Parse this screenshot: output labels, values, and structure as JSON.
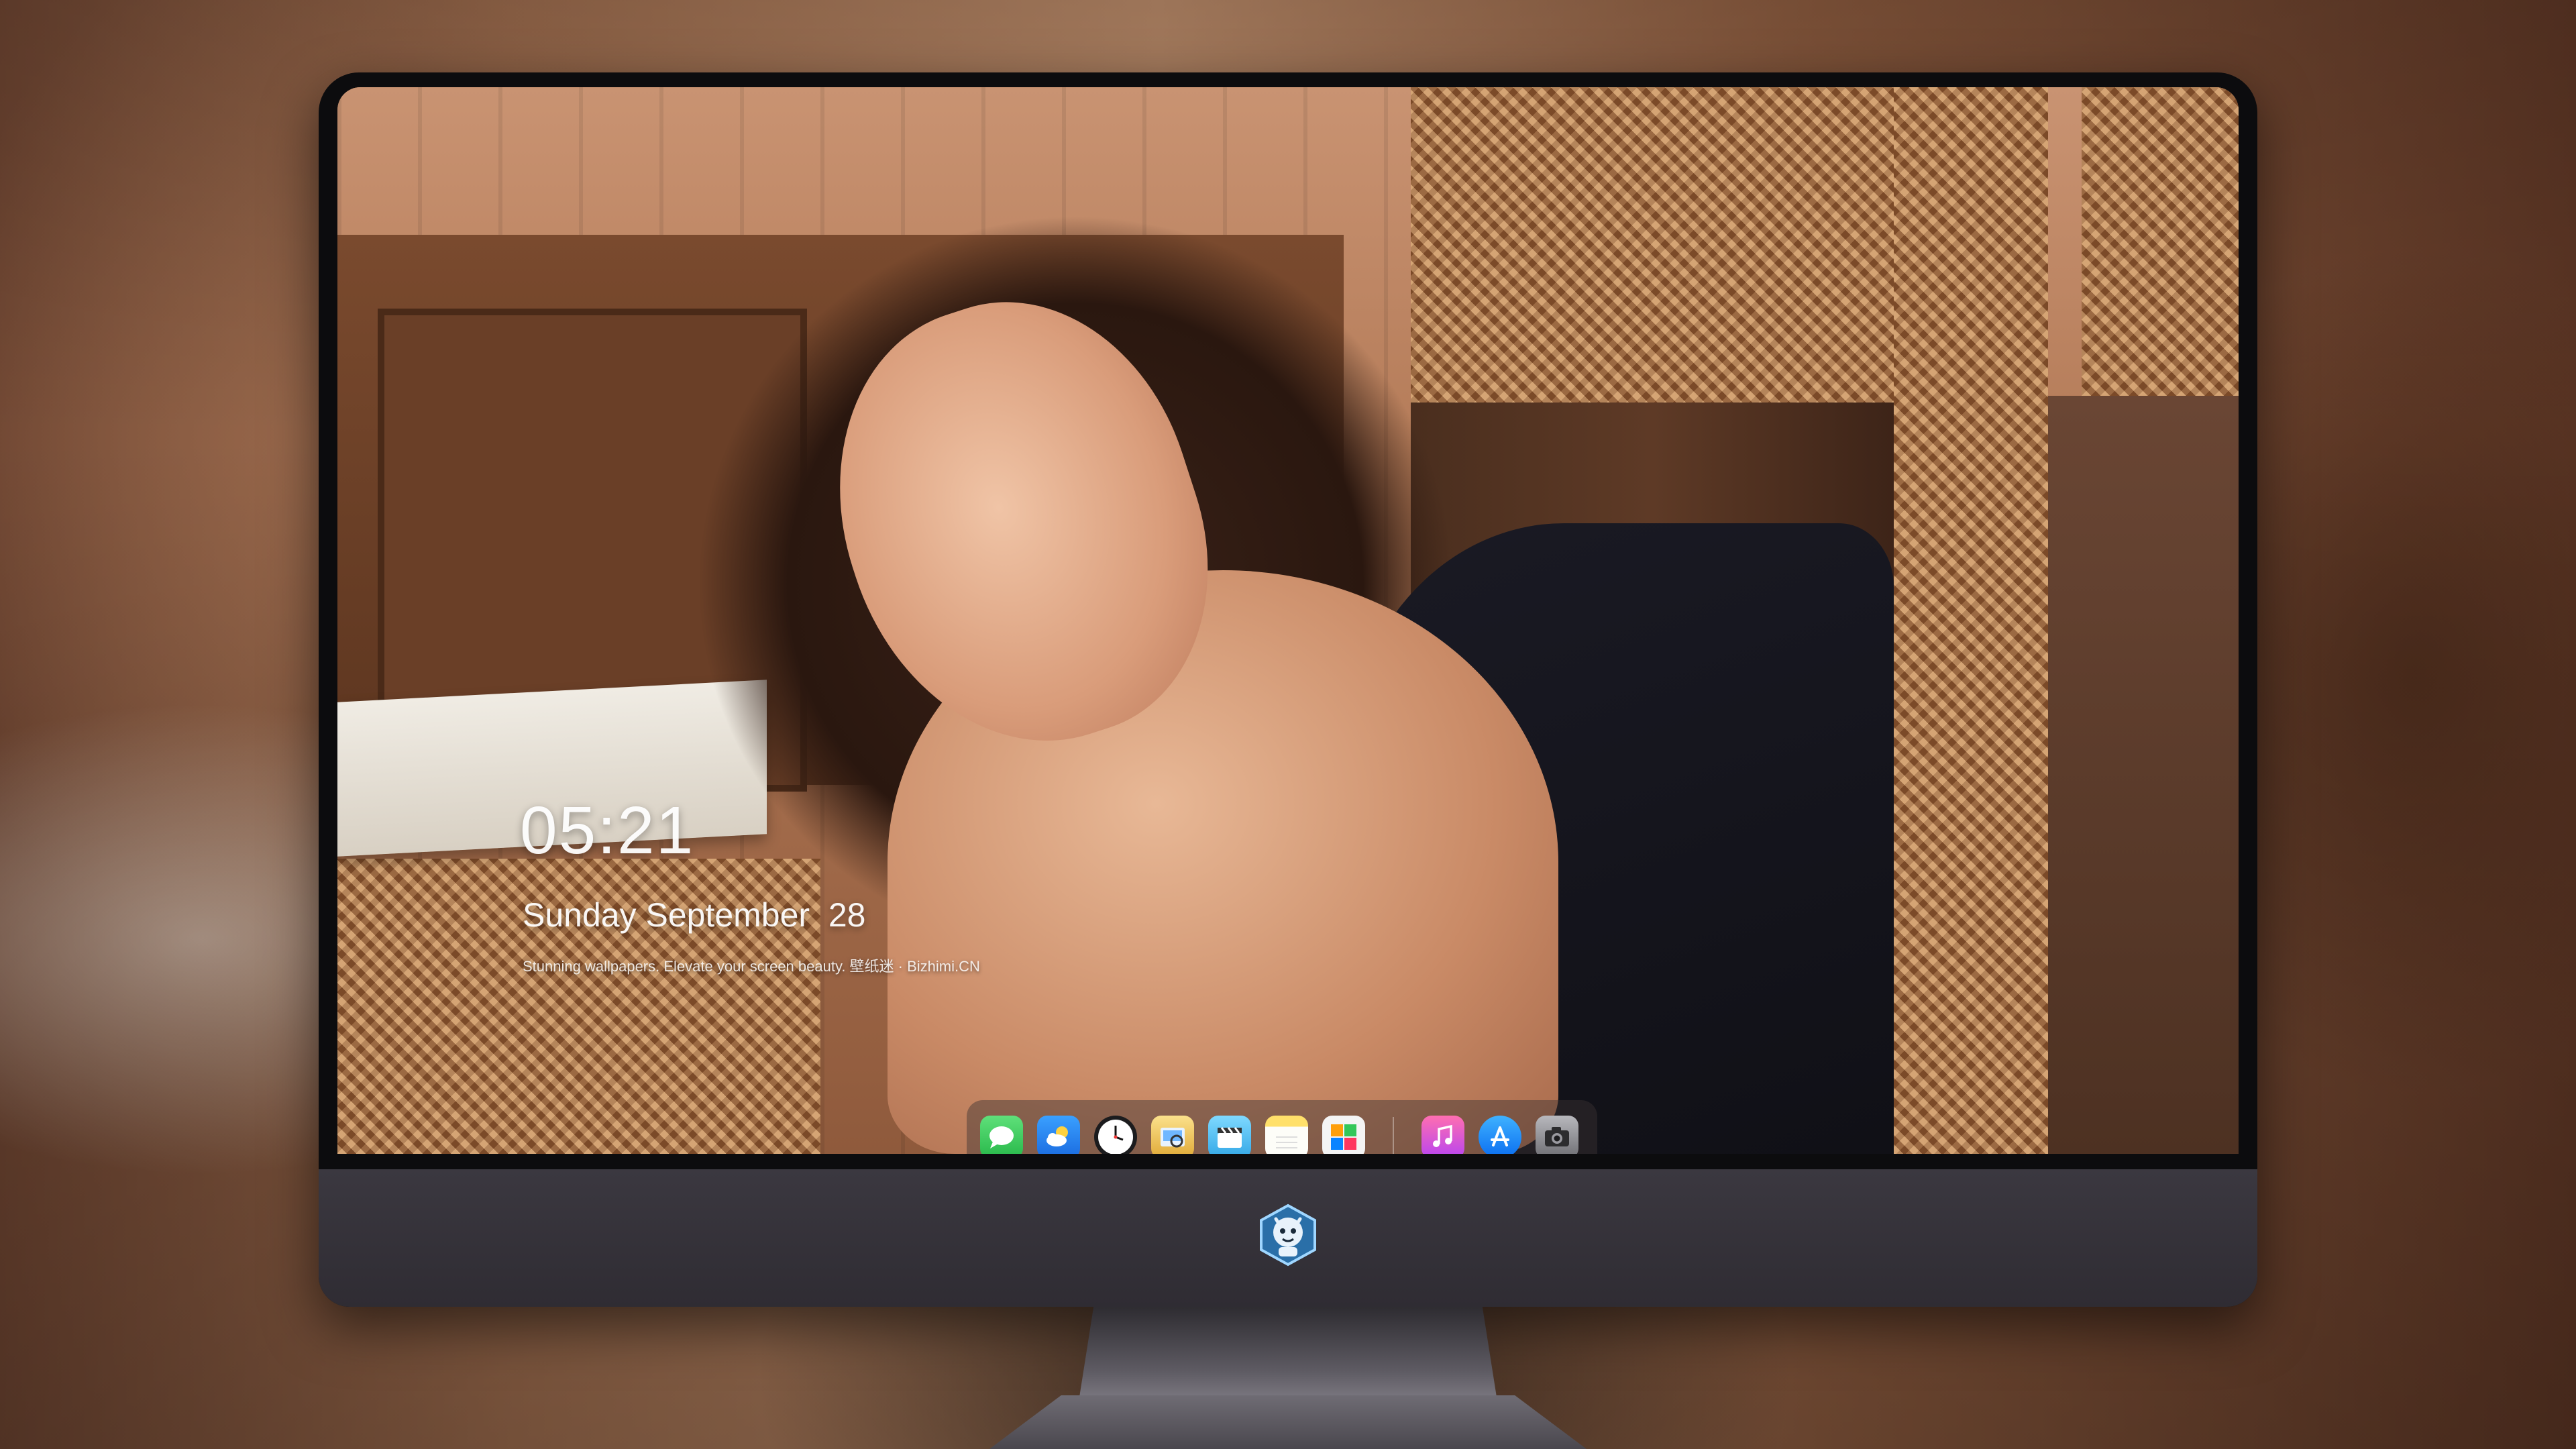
{
  "lock_screen": {
    "time": "05:21",
    "date": "Sunday September  28",
    "tagline": "Stunning wallpapers. Elevate your screen beauty. 壁纸迷 · Bizhimi.CN"
  },
  "dock": {
    "apps": [
      {
        "name": "Messages",
        "icon": "messages-icon",
        "color": "#34c759"
      },
      {
        "name": "Weather",
        "icon": "weather-icon",
        "color": "#2f8bff"
      },
      {
        "name": "Clock",
        "icon": "clock-icon",
        "color": "#ffffff"
      },
      {
        "name": "Preview",
        "icon": "preview-icon",
        "color": "#f5c542"
      },
      {
        "name": "Clips",
        "icon": "clapperboard-icon",
        "color": "#5ac8fa"
      },
      {
        "name": "Notes",
        "icon": "notes-icon",
        "color": "#ffd60a"
      },
      {
        "name": "Photo Booth",
        "icon": "photo-app-icon",
        "color": "#ff9f0a"
      },
      {
        "name": "Music",
        "icon": "music-icon",
        "color": "#fc3c8d"
      },
      {
        "name": "App Store",
        "icon": "app-store-icon",
        "color": "#0a84ff"
      },
      {
        "name": "Camera",
        "icon": "camera-icon",
        "color": "#8e8e93"
      }
    ]
  },
  "monitor": {
    "chin_logo": "mascot-logo-icon"
  }
}
